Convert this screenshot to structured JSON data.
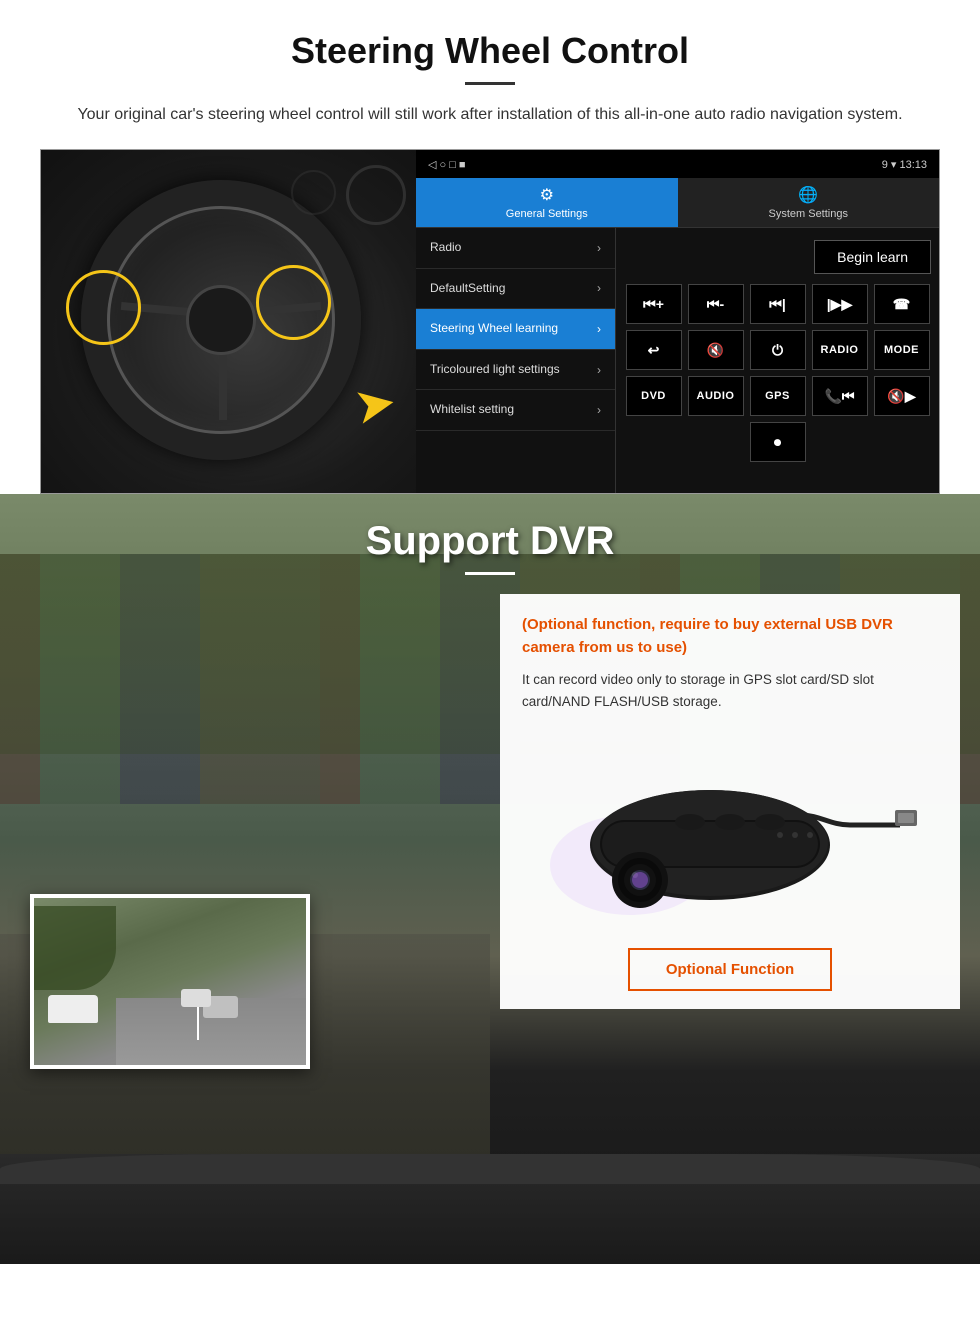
{
  "steering_section": {
    "title": "Steering Wheel Control",
    "subtitle": "Your original car's steering wheel control will still work after installation of this all-in-one auto radio navigation system.",
    "status_bar": {
      "left_icons": "◁  ○  □  ■",
      "right": "9 ▾ 13:13"
    },
    "tabs": [
      {
        "label": "General Settings",
        "icon": "⚙",
        "active": true
      },
      {
        "label": "System Settings",
        "icon": "⊕",
        "active": false
      }
    ],
    "menu_items": [
      {
        "label": "Radio",
        "selected": false
      },
      {
        "label": "DefaultSetting",
        "selected": false
      },
      {
        "label": "Steering Wheel learning",
        "selected": true
      },
      {
        "label": "Tricoloured light settings",
        "selected": false
      },
      {
        "label": "Whitelist setting",
        "selected": false
      }
    ],
    "begin_learn_label": "Begin learn",
    "control_buttons_row1": [
      "⏮+",
      "⏮-",
      "⏮|",
      "|▶▶",
      "☎"
    ],
    "control_buttons_row2": [
      "↩",
      "🔇x",
      "⏻",
      "RADIO",
      "MODE"
    ],
    "control_buttons_row3": [
      "DVD",
      "AUDIO",
      "GPS",
      "📞⏮|",
      "🔇|▶▶"
    ],
    "control_buttons_row4": [
      "⏺"
    ]
  },
  "dvr_section": {
    "title": "Support DVR",
    "optional_heading": "(Optional function, require to buy external USB DVR camera from us to use)",
    "body_text": "It can record video only to storage in GPS slot card/SD slot card/NAND FLASH/USB storage.",
    "optional_function_label": "Optional Function"
  }
}
